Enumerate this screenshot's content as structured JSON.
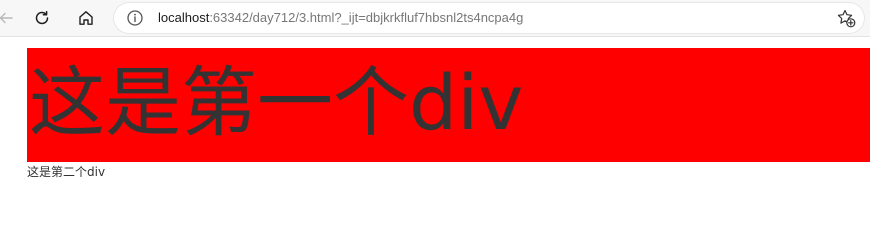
{
  "browser": {
    "url_host": "localhost",
    "url_rest": ":63342/day712/3.html?_ijt=dbjkrkfluf7hbsnl2ts4ncpa4g",
    "icons": {
      "back": "back-arrow-icon",
      "reload": "reload-icon",
      "home": "home-icon",
      "info": "info-icon",
      "favorite": "add-favorite-icon"
    }
  },
  "page": {
    "first_div_text": "这是第一个div",
    "first_div_background": "#ff0000",
    "second_div_text": "这是第二个div",
    "text_color": "#333333"
  }
}
